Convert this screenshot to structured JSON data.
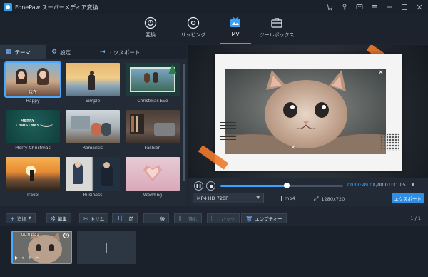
{
  "app": {
    "title": "FonePaw スーパーメディア変換"
  },
  "window_controls": [
    "cart-icon",
    "key-icon",
    "chat-icon",
    "menu-icon",
    "minimize-icon",
    "maximize-icon",
    "close-icon"
  ],
  "nav": {
    "tabs": [
      {
        "label": "変換",
        "icon": "convert-icon",
        "active": false
      },
      {
        "label": "リッピング",
        "icon": "disc-icon",
        "active": false
      },
      {
        "label": "MV",
        "icon": "mv-icon",
        "active": true
      },
      {
        "label": "ツールボックス",
        "icon": "toolbox-icon",
        "active": false
      }
    ]
  },
  "subtabs": [
    {
      "label": "テーマ",
      "icon": "theme-icon",
      "active": true
    },
    {
      "label": "設定",
      "icon": "settings-icon",
      "active": false
    },
    {
      "label": "エクスポート",
      "icon": "export-icon",
      "active": false
    }
  ],
  "themes": [
    {
      "name": "Happy",
      "selected": true,
      "caption": "我在"
    },
    {
      "name": "Simple"
    },
    {
      "name": "Christmas Eve"
    },
    {
      "name": "Merry Christmas",
      "caption": "MERRY\nCHRISTMAS"
    },
    {
      "name": "Romantic"
    },
    {
      "name": "Fashion"
    },
    {
      "name": "Travel"
    },
    {
      "name": "Business"
    },
    {
      "name": "Wedding"
    }
  ],
  "player": {
    "current_time": "00:00:49.08",
    "total_time": "/00:01:31.05",
    "progress": 0.54,
    "format": "MP4 HD 720P",
    "container": "mp4",
    "resolution": "1280x720",
    "export_label": "エクスポート"
  },
  "toolbar": {
    "add": "追加",
    "edit": "編集",
    "trim": "トリム",
    "front": "前",
    "back": "後",
    "forward": "進む",
    "backward": "バック",
    "empty": "エンプティー",
    "page": "1 / 1"
  },
  "timeline": {
    "clip_time": "00:01:31",
    "add_symbol": "+"
  },
  "colors": {
    "accent": "#3aa3ff",
    "export_button": "#2f8fe6",
    "tape": "#f07a2a"
  }
}
